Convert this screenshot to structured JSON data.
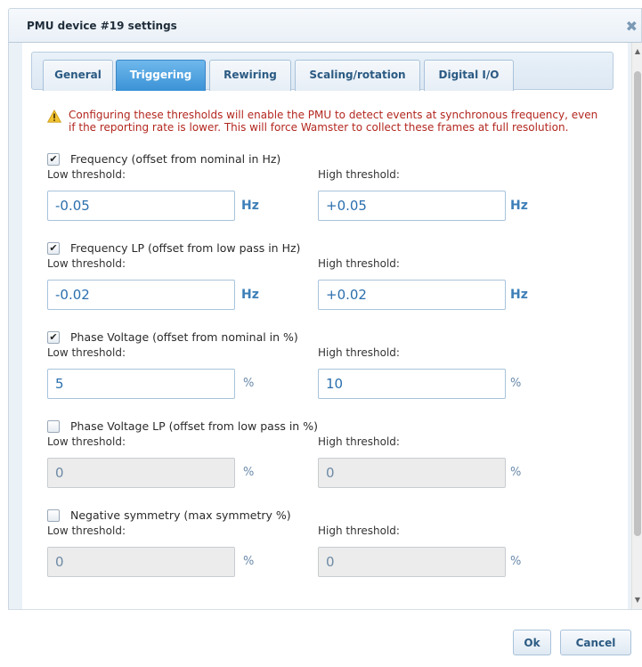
{
  "dialog": {
    "title": "PMU device #19 settings",
    "close_icon": "✖"
  },
  "tabs": [
    {
      "label": "General"
    },
    {
      "label": "Triggering"
    },
    {
      "label": "Rewiring"
    },
    {
      "label": "Scaling/rotation"
    },
    {
      "label": "Digital I/O"
    }
  ],
  "active_tab": "Triggering",
  "warning": {
    "text": "Configuring these thresholds will enable the PMU to detect events at synchronous frequency, even if the reporting rate is lower. This will force Wamster to collect these frames at full resolution.",
    "icon": "warning-triangle-icon"
  },
  "groups": [
    {
      "label": "Frequency (offset from nominal in Hz)",
      "checked": true,
      "low_label": "Low threshold:",
      "high_label": "High threshold:",
      "low": "-0.05",
      "high": "+0.05",
      "unit": "Hz",
      "enabled": true
    },
    {
      "label": "Frequency LP (offset from low pass in Hz)",
      "checked": true,
      "low_label": "Low threshold:",
      "high_label": "High threshold:",
      "low": "-0.02",
      "high": "+0.02",
      "unit": "Hz",
      "enabled": true
    },
    {
      "label": "Phase Voltage (offset from nominal in %)",
      "checked": true,
      "low_label": "Low threshold:",
      "high_label": "High threshold:",
      "low": "5",
      "high": "10",
      "unit": "%",
      "enabled": true
    },
    {
      "label": "Phase Voltage LP (offset from low pass in %)",
      "checked": false,
      "low_label": "Low threshold:",
      "high_label": "High threshold:",
      "low": "0",
      "high": "0",
      "unit": "%",
      "enabled": false
    },
    {
      "label": "Negative symmetry (max symmetry %)",
      "checked": false,
      "low_label": "Low threshold:",
      "high_label": "High threshold:",
      "low": "0",
      "high": "0",
      "unit": "%",
      "enabled": false
    }
  ],
  "footer": {
    "ok_label": "Ok",
    "cancel_label": "Cancel"
  },
  "colors": {
    "accent": "#3b92d6",
    "warning": "#b3271f",
    "input_text": "#2b6fae"
  }
}
